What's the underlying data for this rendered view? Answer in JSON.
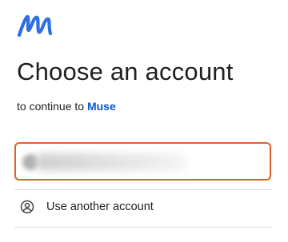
{
  "brand": {
    "logo_icon": "muse-logo-icon",
    "accent_color": "#2f6fe4"
  },
  "heading": {
    "title": "Choose an account",
    "continue_prefix": "to continue to",
    "app_name": "Muse",
    "app_color": "#0b57d0"
  },
  "accounts": {
    "selected_highlight_color": "#e0602a",
    "items": [
      {
        "redacted": true
      }
    ]
  },
  "another_account": {
    "icon": "account-circle-icon",
    "label": "Use another account"
  }
}
